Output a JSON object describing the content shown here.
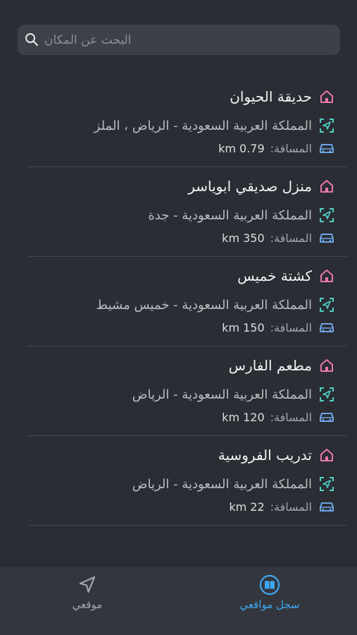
{
  "search": {
    "placeholder": "البحث عن المكان"
  },
  "places": [
    {
      "title": "حديقة الحيوان",
      "address": "المملكة العربية السعودية - الرياض ، الملز",
      "distance_label": "المسافة:",
      "distance_value": "km 0.79"
    },
    {
      "title": "منزل صديقي ابوياسر",
      "address": "المملكة العربية السعودية - جدة",
      "distance_label": "المسافة:",
      "distance_value": "km 350"
    },
    {
      "title": "كشتة خميس",
      "address": "المملكة العربية السعودية - خميس مشيط",
      "distance_label": "المسافة:",
      "distance_value": "km 150"
    },
    {
      "title": "مطعم الفارس",
      "address": "المملكة العربية السعودية - الرياض",
      "distance_label": "المسافة:",
      "distance_value": "km 120"
    },
    {
      "title": "تدريب الفروسية",
      "address": "المملكة العربية السعودية - الرياض",
      "distance_label": "المسافة:",
      "distance_value": "km  22"
    }
  ],
  "tabbar": {
    "my_locations_log": "سجل مواقعي",
    "my_location": "موقعي"
  },
  "icons": {
    "search": "search-icon",
    "place": "home-icon",
    "address": "location-scan-icon",
    "distance": "car-icon",
    "tab_log": "book-icon",
    "tab_location": "navigation-arrow-icon"
  },
  "colors": {
    "background": "#2a2d33",
    "home_icon": "#e879a6",
    "address_icon": "#4fd1c5",
    "car_icon": "#6fa4e8",
    "active_tab": "#3fa7f2"
  }
}
